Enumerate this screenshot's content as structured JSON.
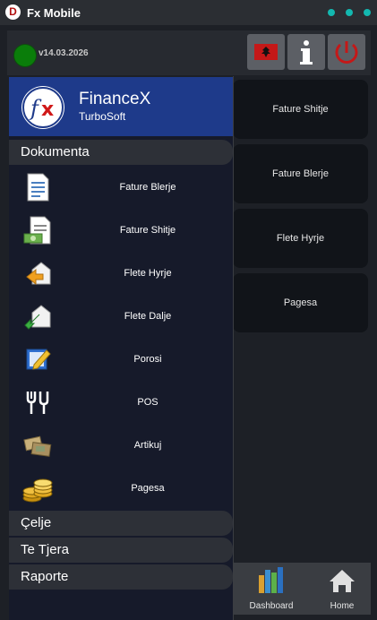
{
  "window": {
    "title": "Fx Mobile",
    "icon_letter": "D"
  },
  "header": {
    "version": "v14.03.2026"
  },
  "drawer": {
    "brand": "FinanceX",
    "brand_sub": "TurboSoft",
    "logo_text": "fx",
    "section": "Dokumenta",
    "items": [
      {
        "label": "Fature Blerje",
        "icon": "invoice-icon"
      },
      {
        "label": "Fature Shitje",
        "icon": "sales-invoice-icon"
      },
      {
        "label": "Flete Hyrje",
        "icon": "entry-arrow-icon"
      },
      {
        "label": "Flete Dalje",
        "icon": "exit-arrow-icon"
      },
      {
        "label": "Porosi",
        "icon": "order-pencil-icon"
      },
      {
        "label": "POS",
        "icon": "fork-cup-icon"
      },
      {
        "label": "Artikuj",
        "icon": "items-icon"
      },
      {
        "label": "Pagesa",
        "icon": "coins-icon"
      }
    ],
    "groups": [
      "Çelje",
      "Te Tjera",
      "Raporte"
    ]
  },
  "main": {
    "tiles": [
      "Fature Shitje",
      "Fature Blerje",
      "Flete Hyrje",
      "Pagesa"
    ]
  },
  "bottom_nav": {
    "dashboard": "Dashboard",
    "home": "Home"
  },
  "colors": {
    "accent": "#13b8b0",
    "drawer_header": "#1e3a8a",
    "status": "#0a7d0a",
    "power": "#c41818"
  }
}
